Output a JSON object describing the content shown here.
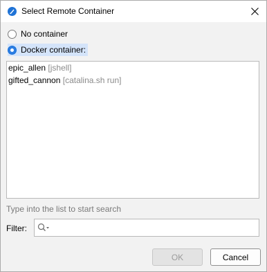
{
  "window": {
    "title": "Select Remote Container"
  },
  "options": {
    "no_container": "No container",
    "docker_container": "Docker container:"
  },
  "containers": [
    {
      "name": "epic_allen",
      "detail": "[jshell]"
    },
    {
      "name": "gifted_cannon",
      "detail": "[catalina.sh run]"
    }
  ],
  "hint": "Type into the list to start search",
  "filter": {
    "label": "Filter:",
    "value": ""
  },
  "buttons": {
    "ok": "OK",
    "cancel": "Cancel"
  },
  "colors": {
    "accent": "#2c7ee3",
    "selection": "#d4e4fa"
  }
}
